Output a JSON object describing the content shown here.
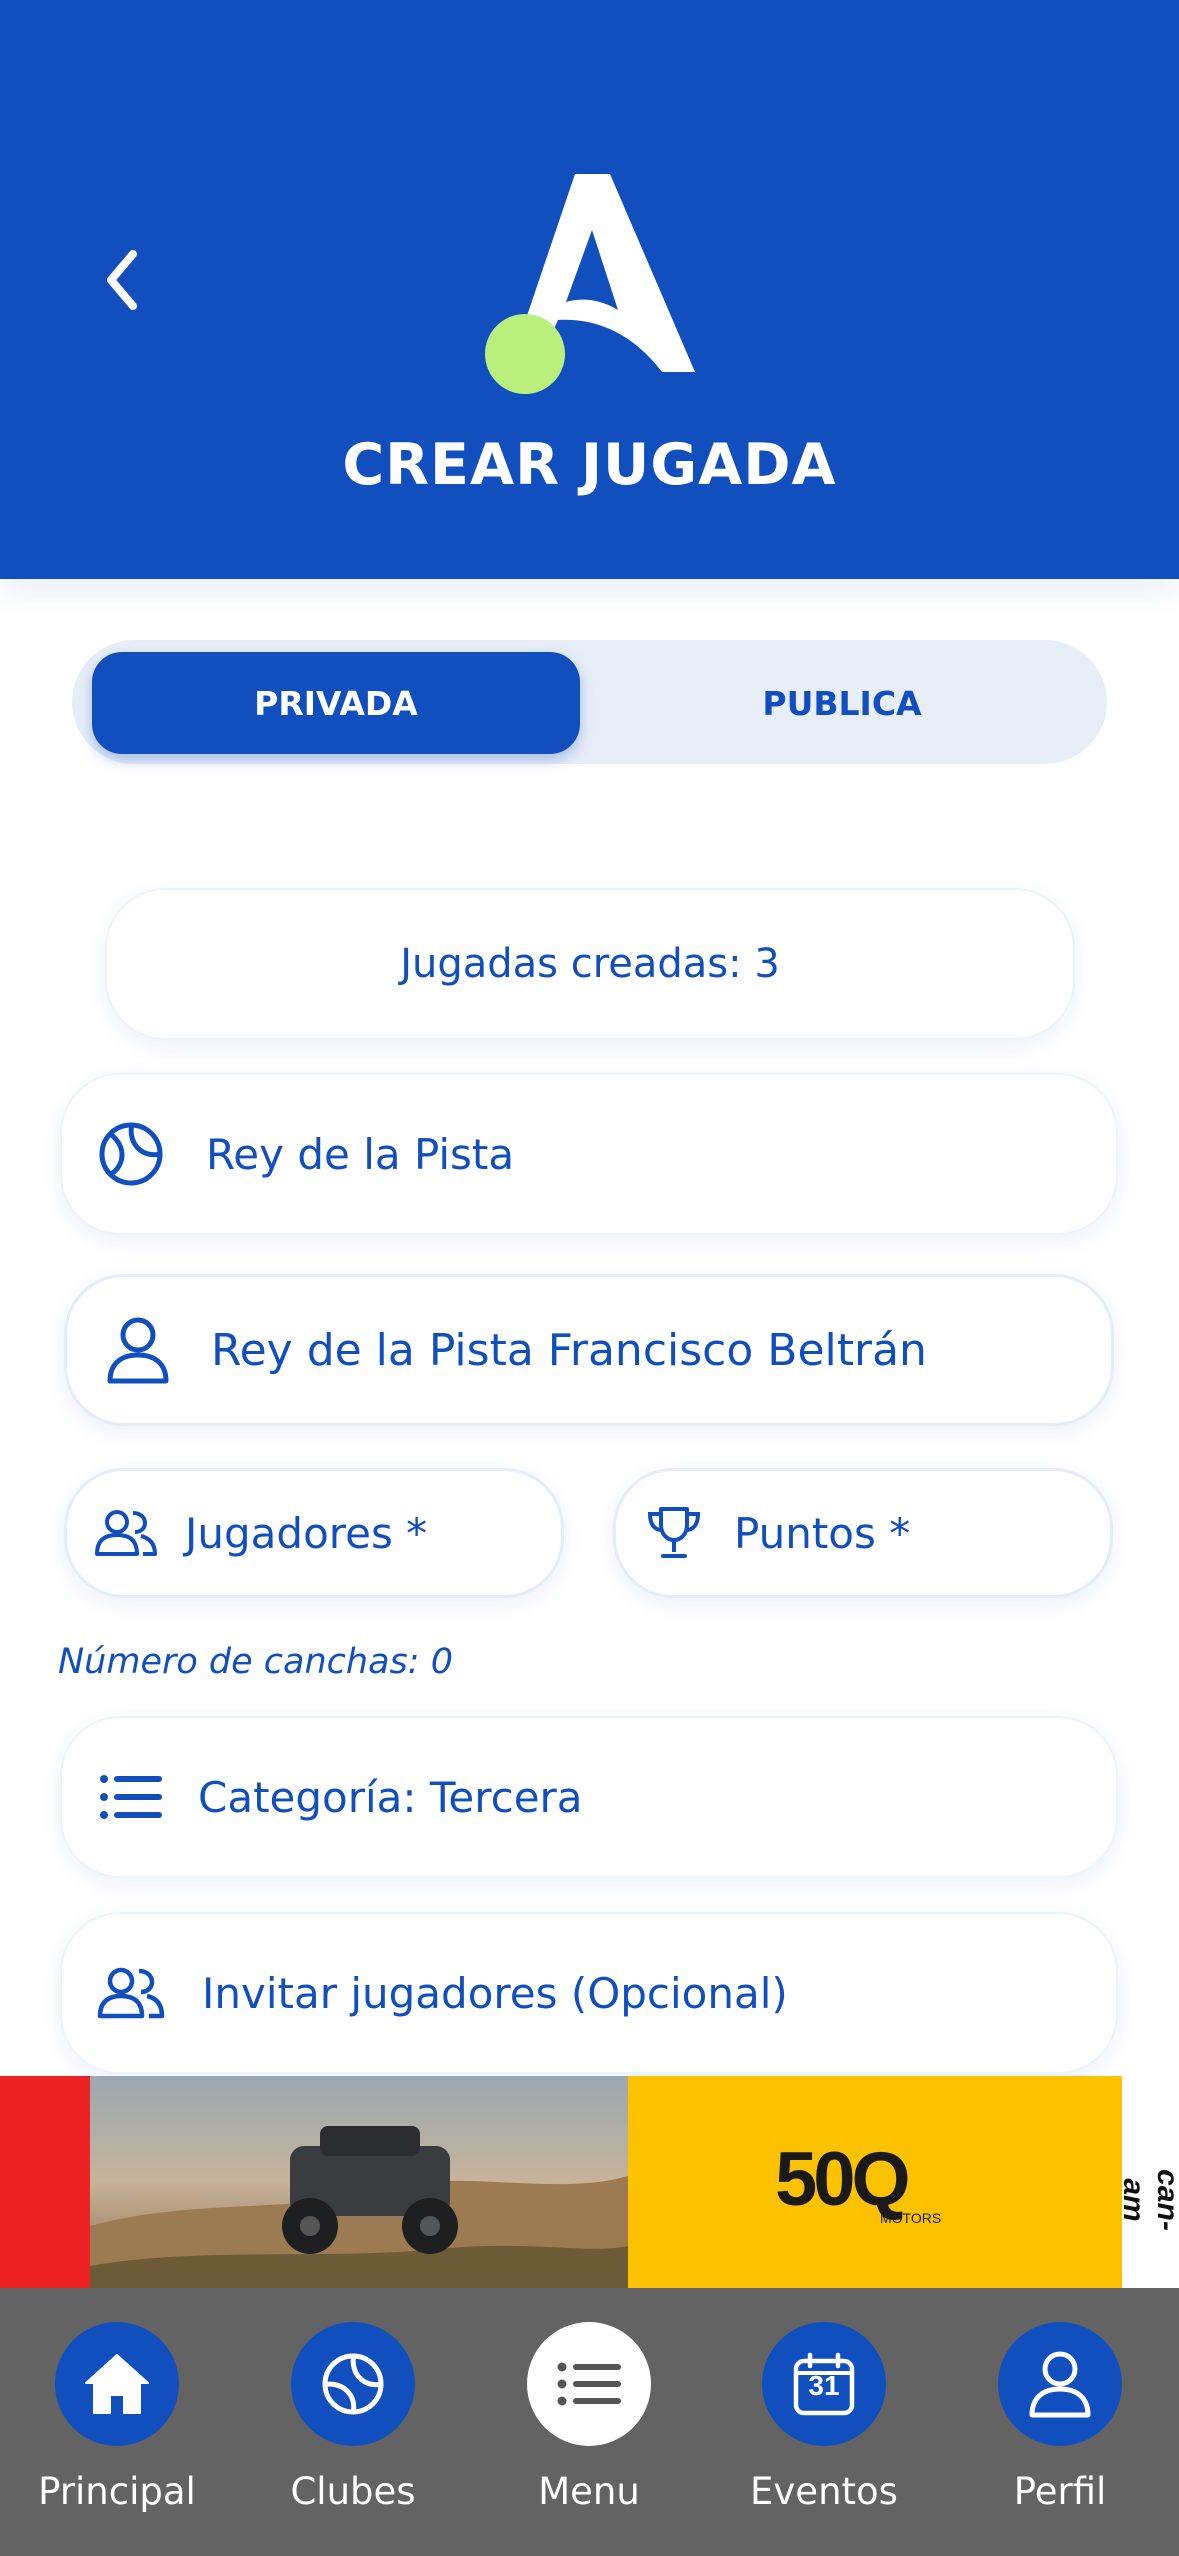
{
  "header": {
    "title": "CREAR JUGADA",
    "background_color": "#124fbe",
    "logo_accent_color": "#b9ef7c"
  },
  "segmented": {
    "active_label": "PRIVADA",
    "inactive_label": "PUBLICA"
  },
  "form": {
    "jugadas_creadas": "Jugadas creadas: 3",
    "game_type": "Rey de la Pista",
    "game_name": "Rey de la Pista Francisco Beltrán",
    "players_placeholder": "Jugadores *",
    "points_placeholder": "Puntos *",
    "num_canchas": "Número de canchas: 0",
    "category": "Categoría: Tercera",
    "invite": "Invitar jugadores (Opcional)"
  },
  "ad": {
    "brand_text": "50Q",
    "brand_sub": "MOTORS",
    "side_text": "can-am"
  },
  "nav": {
    "items": [
      {
        "label": "Principal",
        "icon": "home-icon"
      },
      {
        "label": "Clubes",
        "icon": "tennis-ball-icon"
      },
      {
        "label": "Menu",
        "icon": "menu-list-icon"
      },
      {
        "label": "Eventos",
        "icon": "calendar-icon",
        "icon_text": "31"
      },
      {
        "label": "Perfil",
        "icon": "profile-icon"
      }
    ]
  }
}
